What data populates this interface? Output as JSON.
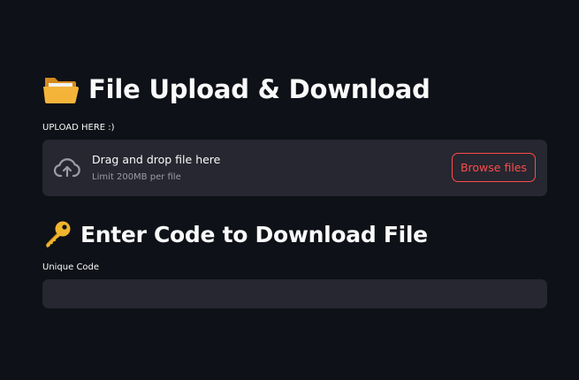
{
  "header": {
    "title": "File Upload & Download",
    "title_icon": "open-folder-icon"
  },
  "uploader": {
    "label": "UPLOAD HERE :)",
    "instructions": "Drag and drop file here",
    "limit": "Limit 200MB per file",
    "browse_label": "Browse files",
    "icon": "cloud-upload-icon"
  },
  "download": {
    "title": "Enter Code to Download File",
    "title_icon": "key-icon",
    "code_label": "Unique Code",
    "code_value": "",
    "code_placeholder": ""
  },
  "colors": {
    "background": "#0e1117",
    "surface": "#262730",
    "accent": "#ff4b4b",
    "text": "#fafafa",
    "muted": "#9c9ca6",
    "folder": "#f4b43a",
    "key": "#f0b52e"
  }
}
